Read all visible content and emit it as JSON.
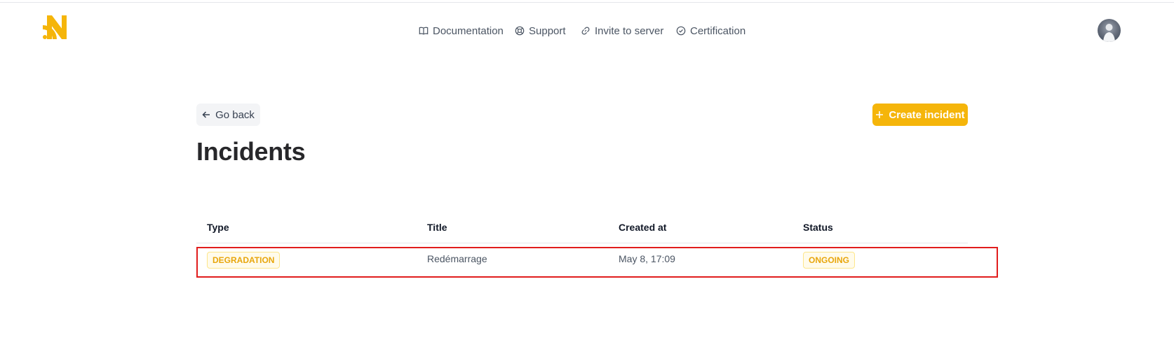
{
  "nav": {
    "items": [
      {
        "label": "Documentation",
        "icon": "book-icon"
      },
      {
        "label": "Support",
        "icon": "lifebuoy-icon"
      },
      {
        "label": "Invite to server",
        "icon": "link-icon"
      },
      {
        "label": "Certification",
        "icon": "check-circle-icon"
      }
    ]
  },
  "page": {
    "back_label": "Go back",
    "create_label": "Create incident",
    "title": "Incidents"
  },
  "table": {
    "headers": [
      "Type",
      "Title",
      "Created at",
      "Status"
    ],
    "rows": [
      {
        "type": "DEGRADATION",
        "title": "Redémarrage",
        "created_at": "May 8, 17:09",
        "status": "ONGOING"
      }
    ]
  },
  "colors": {
    "brand": "#f5b50a",
    "badge_text": "#e8a60c",
    "highlight": "#e11d1d"
  }
}
